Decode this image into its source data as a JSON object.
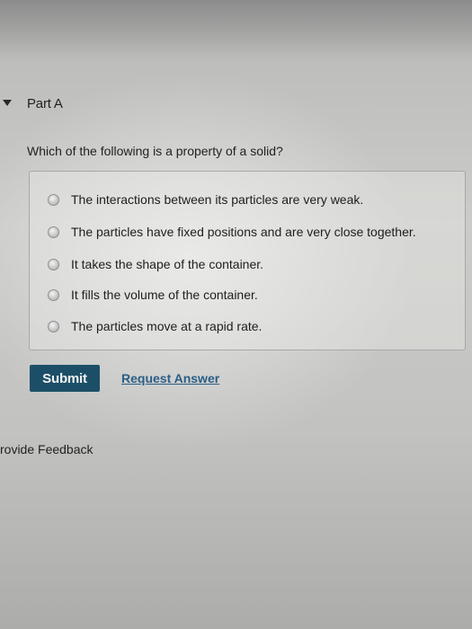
{
  "part": {
    "title": "Part A"
  },
  "question": {
    "text": "Which of the following is a property of a solid?"
  },
  "options": [
    {
      "label": "The interactions between its particles are very weak."
    },
    {
      "label": "The particles have fixed positions and are very close together."
    },
    {
      "label": "It takes the shape of the container."
    },
    {
      "label": "It fills the volume of the container."
    },
    {
      "label": "The particles move at a rapid rate."
    }
  ],
  "actions": {
    "submit_label": "Submit",
    "request_answer_label": "Request Answer"
  },
  "footer": {
    "feedback_label": "rovide Feedback"
  },
  "colors": {
    "submit_bg": "#1c4f67",
    "link": "#2a5f86"
  },
  "icons": {
    "collapse": "caret-down-icon",
    "radio": "radio-icon"
  }
}
